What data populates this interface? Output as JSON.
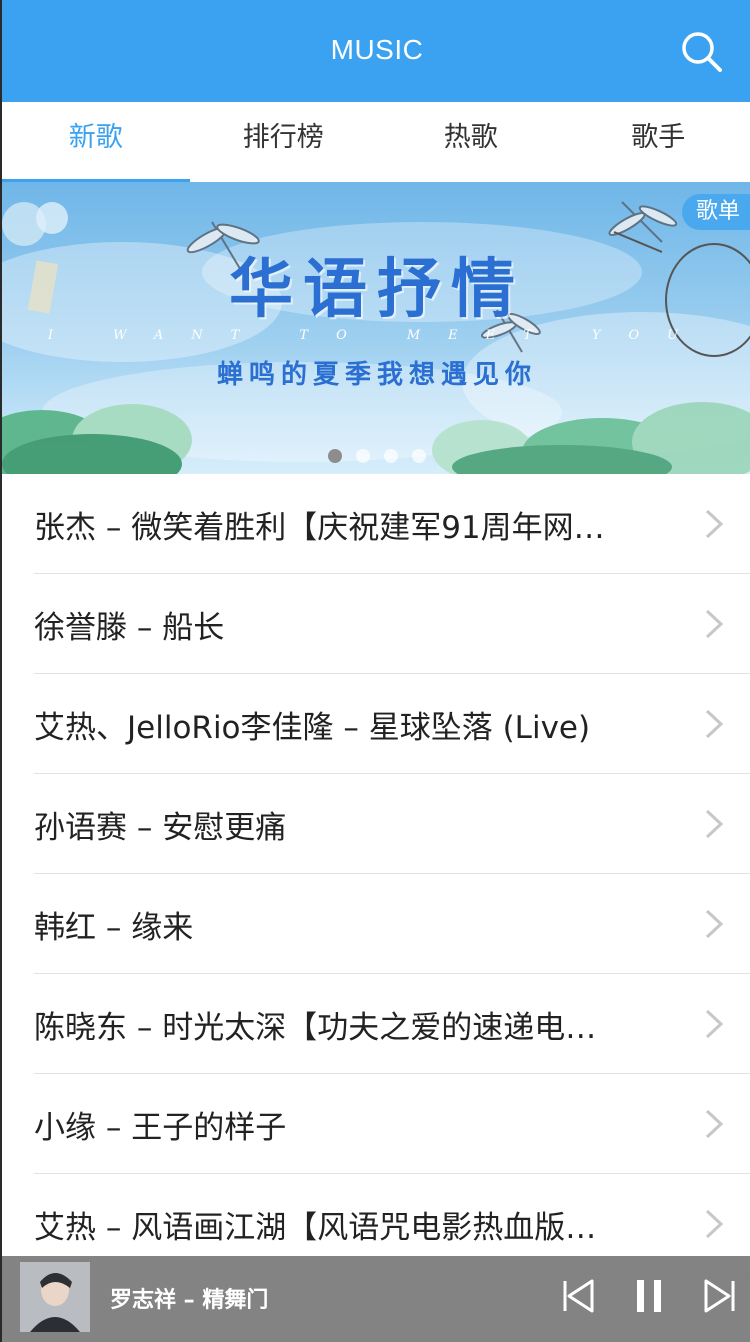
{
  "header": {
    "title": "MUSIC",
    "search_icon": "search-icon"
  },
  "tabs": [
    {
      "label": "新歌",
      "active": true
    },
    {
      "label": "排行榜",
      "active": false
    },
    {
      "label": "热歌",
      "active": false
    },
    {
      "label": "歌手",
      "active": false
    }
  ],
  "banner": {
    "tag": "歌单",
    "title": "华语抒情",
    "subtitle_en": "I WANT TO MEET YOU",
    "subtitle_cn": "蝉鸣的夏季我想遇见你",
    "slides_total": 4,
    "active_slide": 1
  },
  "songs": [
    "张杰 – 微笑着胜利【庆祝建军91周年网…",
    "徐誉滕 – 船长",
    "艾热、JelloRio李佳隆 – 星球坠落 (Live)",
    "孙语赛 – 安慰更痛",
    "韩红 – 缘来",
    "陈晓东 – 时光太深【功夫之爱的速递电…",
    "小缘 – 王子的样子",
    "艾热 – 风语画江湖【风语咒电影热血版…"
  ],
  "player": {
    "now_playing": "罗志祥 – 精舞门",
    "controls": [
      "previous-icon",
      "pause-icon",
      "next-icon"
    ]
  },
  "colors": {
    "accent": "#3aa2f1",
    "player_bg": "#787878"
  }
}
